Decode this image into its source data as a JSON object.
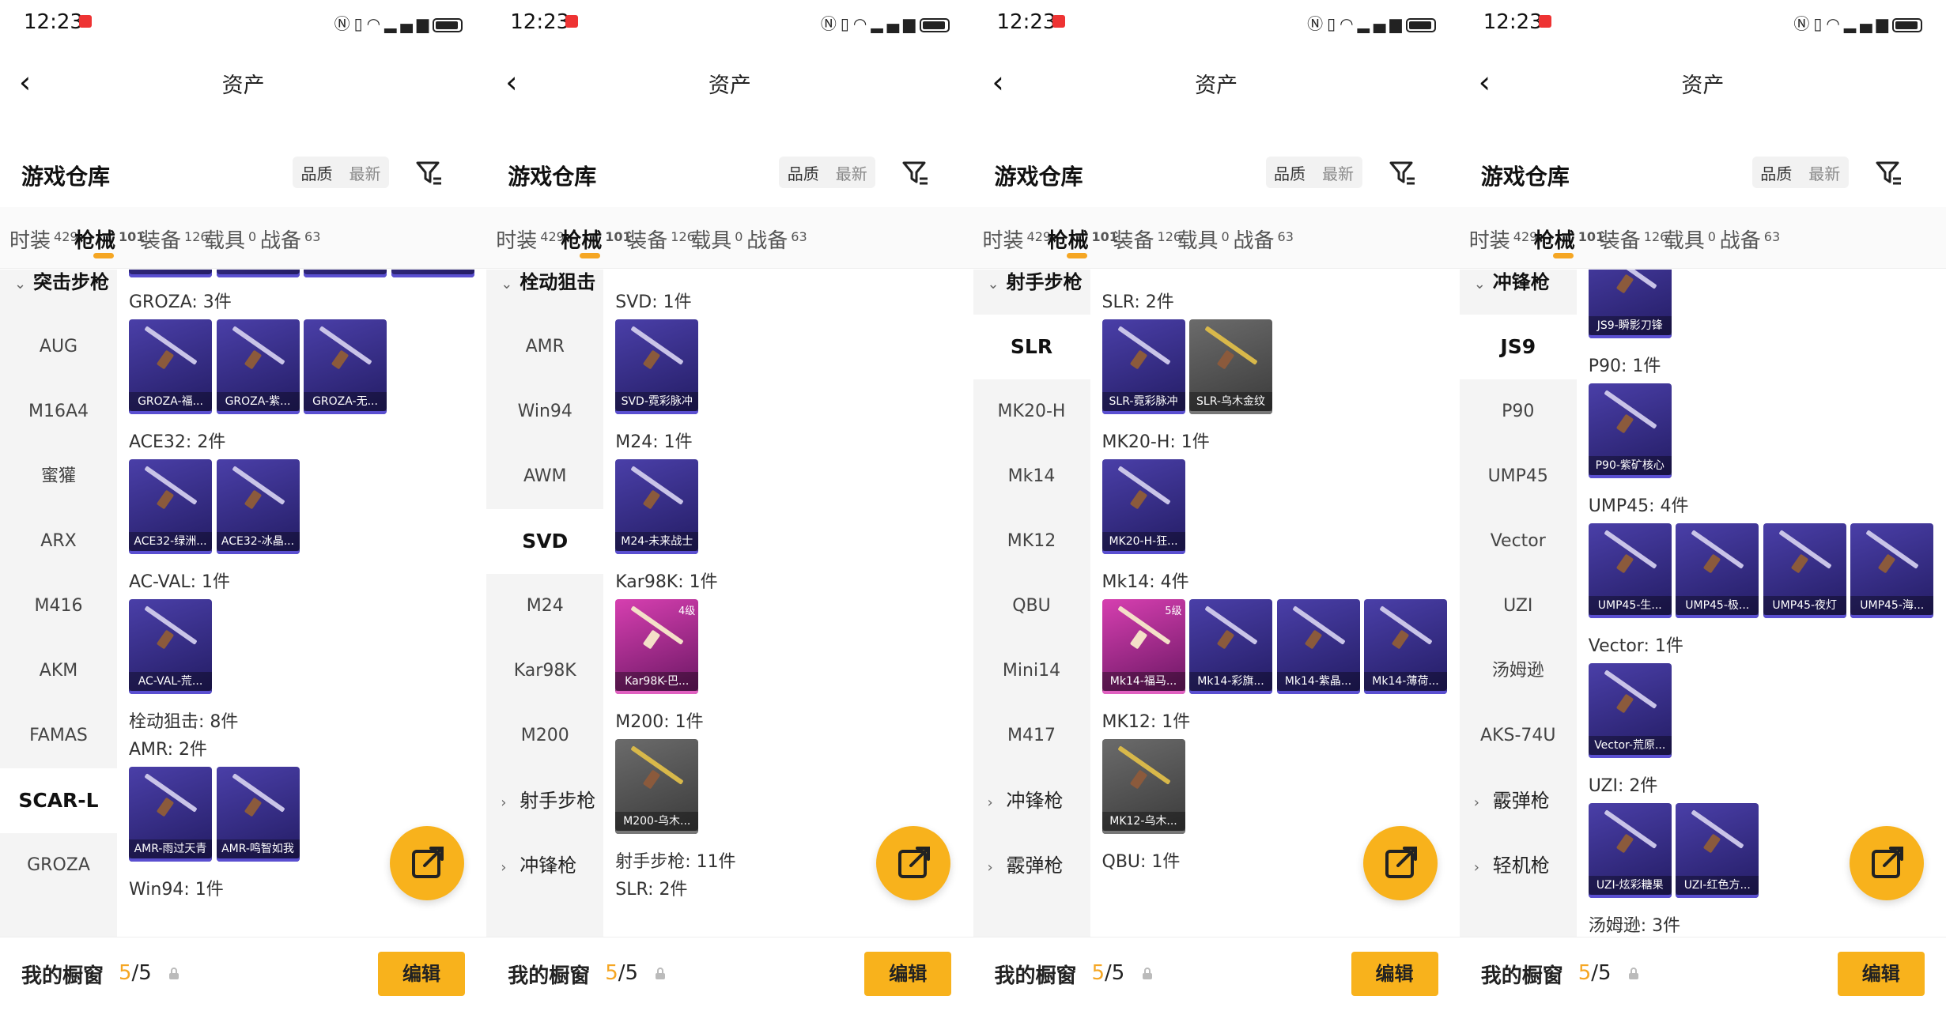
{
  "phones": [
    {
      "status": {
        "time": "12:23"
      },
      "nav": {
        "title": "资产"
      },
      "repo": {
        "title": "游戏仓库",
        "sort_quality": "品质",
        "sort_latest": "最新"
      },
      "tabs": [
        {
          "label": "时装",
          "count": "429"
        },
        {
          "label": "枪械",
          "count": "101"
        },
        {
          "label": "装备",
          "count": "126"
        },
        {
          "label": "载具",
          "count": "0"
        },
        {
          "label": "战备",
          "count": "63"
        }
      ],
      "sidebar": [
        {
          "label": "突击步枪",
          "kind": "group-open"
        },
        {
          "label": "AUG"
        },
        {
          "label": "M16A4"
        },
        {
          "label": "蜜獾"
        },
        {
          "label": "ARX"
        },
        {
          "label": "M416"
        },
        {
          "label": "AKM"
        },
        {
          "label": "FAMAS"
        },
        {
          "label": "SCAR-L",
          "selected": true
        },
        {
          "label": "GROZA"
        }
      ],
      "sections": [
        {
          "title": "GROZA: 3件",
          "items": [
            {
              "name": "GROZA-福...",
              "color": "purple"
            },
            {
              "name": "GROZA-紫...",
              "color": "purple"
            },
            {
              "name": "GROZA-无...",
              "color": "purple"
            }
          ]
        },
        {
          "title": "ACE32: 2件",
          "items": [
            {
              "name": "ACE32-绿洲...",
              "color": "purple"
            },
            {
              "name": "ACE32-冰晶...",
              "color": "purple"
            }
          ]
        },
        {
          "title": "AC-VAL: 1件",
          "items": [
            {
              "name": "AC-VAL-荒...",
              "color": "purple"
            }
          ]
        },
        {
          "title": "栓动狙击: 8件",
          "items": []
        },
        {
          "title": "AMR: 2件",
          "items": [
            {
              "name": "AMR-雨过天青",
              "color": "purple"
            },
            {
              "name": "AMR-鸣智如我",
              "color": "purple"
            }
          ]
        },
        {
          "title": "Win94: 1件",
          "items": []
        }
      ],
      "vitrine": {
        "label": "我的橱窗",
        "current": "5",
        "total": "/5"
      },
      "edit_label": "编辑"
    },
    {
      "status": {
        "time": "12:23"
      },
      "nav": {
        "title": "资产"
      },
      "repo": {
        "title": "游戏仓库",
        "sort_quality": "品质",
        "sort_latest": "最新"
      },
      "tabs": [
        {
          "label": "时装",
          "count": "429"
        },
        {
          "label": "枪械",
          "count": "101"
        },
        {
          "label": "装备",
          "count": "126"
        },
        {
          "label": "载具",
          "count": "0"
        },
        {
          "label": "战备",
          "count": "63"
        }
      ],
      "sidebar": [
        {
          "label": "栓动狙击",
          "kind": "group-open"
        },
        {
          "label": "AMR"
        },
        {
          "label": "Win94"
        },
        {
          "label": "AWM"
        },
        {
          "label": "SVD",
          "selected": true
        },
        {
          "label": "M24"
        },
        {
          "label": "Kar98K"
        },
        {
          "label": "M200"
        },
        {
          "label": "射手步枪",
          "kind": "group"
        },
        {
          "label": "冲锋枪",
          "kind": "group"
        }
      ],
      "sections": [
        {
          "title": "SVD: 1件",
          "items": [
            {
              "name": "SVD-霓彩脉冲",
              "color": "purple"
            }
          ]
        },
        {
          "title": "M24: 1件",
          "items": [
            {
              "name": "M24-未来战士",
              "color": "purple"
            }
          ]
        },
        {
          "title": "Kar98K: 1件",
          "items": [
            {
              "name": "Kar98K-巴...",
              "color": "pink",
              "badge": "4级"
            }
          ]
        },
        {
          "title": "M200: 1件",
          "items": [
            {
              "name": "M200-乌木...",
              "color": "gray"
            }
          ]
        },
        {
          "title": "射手步枪: 11件",
          "items": []
        },
        {
          "title": "SLR: 2件",
          "items": []
        }
      ],
      "vitrine": {
        "label": "我的橱窗",
        "current": "5",
        "total": "/5"
      },
      "edit_label": "编辑"
    },
    {
      "status": {
        "time": "12:23"
      },
      "nav": {
        "title": "资产"
      },
      "repo": {
        "title": "游戏仓库",
        "sort_quality": "品质",
        "sort_latest": "最新"
      },
      "tabs": [
        {
          "label": "时装",
          "count": "429"
        },
        {
          "label": "枪械",
          "count": "101"
        },
        {
          "label": "装备",
          "count": "126"
        },
        {
          "label": "载具",
          "count": "0"
        },
        {
          "label": "战备",
          "count": "63"
        }
      ],
      "sidebar": [
        {
          "label": "射手步枪",
          "kind": "group-open"
        },
        {
          "label": "SLR",
          "selected": true
        },
        {
          "label": "MK20-H"
        },
        {
          "label": "Mk14"
        },
        {
          "label": "MK12"
        },
        {
          "label": "QBU"
        },
        {
          "label": "Mini14"
        },
        {
          "label": "M417"
        },
        {
          "label": "冲锋枪",
          "kind": "group"
        },
        {
          "label": "霰弹枪",
          "kind": "group"
        }
      ],
      "sections": [
        {
          "title": "SLR: 2件",
          "items": [
            {
              "name": "SLR-霓彩脉冲",
              "color": "purple"
            },
            {
              "name": "SLR-乌木金纹",
              "color": "gray"
            }
          ]
        },
        {
          "title": "MK20-H: 1件",
          "items": [
            {
              "name": "MK20-H-狂...",
              "color": "purple"
            }
          ]
        },
        {
          "title": "Mk14: 4件",
          "items": [
            {
              "name": "Mk14-福马...",
              "color": "pink",
              "badge": "5级"
            },
            {
              "name": "Mk14-彩旗...",
              "color": "purple"
            },
            {
              "name": "Mk14-紫晶...",
              "color": "purple"
            },
            {
              "name": "Mk14-薄荷...",
              "color": "purple"
            }
          ]
        },
        {
          "title": "MK12: 1件",
          "items": [
            {
              "name": "MK12-乌木...",
              "color": "gray"
            }
          ]
        },
        {
          "title": "QBU: 1件",
          "items": []
        }
      ],
      "vitrine": {
        "label": "我的橱窗",
        "current": "5",
        "total": "/5"
      },
      "edit_label": "编辑"
    },
    {
      "status": {
        "time": "12:23"
      },
      "nav": {
        "title": "资产"
      },
      "repo": {
        "title": "游戏仓库",
        "sort_quality": "品质",
        "sort_latest": "最新"
      },
      "tabs": [
        {
          "label": "时装",
          "count": "429"
        },
        {
          "label": "枪械",
          "count": "101"
        },
        {
          "label": "装备",
          "count": "126"
        },
        {
          "label": "载具",
          "count": "0"
        },
        {
          "label": "战备",
          "count": "63"
        }
      ],
      "sidebar": [
        {
          "label": "冲锋枪",
          "kind": "group-open"
        },
        {
          "label": "JS9",
          "selected": true
        },
        {
          "label": "P90"
        },
        {
          "label": "UMP45"
        },
        {
          "label": "Vector"
        },
        {
          "label": "UZI"
        },
        {
          "label": "汤姆逊"
        },
        {
          "label": "AKS-74U"
        },
        {
          "label": "霰弹枪",
          "kind": "group"
        },
        {
          "label": "轻机枪",
          "kind": "group"
        }
      ],
      "sections": [
        {
          "title": "",
          "items": [
            {
              "name": "JS9-瞬影刀锋",
              "color": "purple"
            }
          ]
        },
        {
          "title": "P90: 1件",
          "items": [
            {
              "name": "P90-紫矿核心",
              "color": "purple"
            }
          ]
        },
        {
          "title": "UMP45: 4件",
          "items": [
            {
              "name": "UMP45-生...",
              "color": "purple"
            },
            {
              "name": "UMP45-极...",
              "color": "purple"
            },
            {
              "name": "UMP45-夜灯",
              "color": "purple"
            },
            {
              "name": "UMP45-海...",
              "color": "purple"
            }
          ]
        },
        {
          "title": "Vector: 1件",
          "items": [
            {
              "name": "Vector-荒原...",
              "color": "purple"
            }
          ]
        },
        {
          "title": "UZI: 2件",
          "items": [
            {
              "name": "UZI-炫彩糖果",
              "color": "purple"
            },
            {
              "name": "UZI-红色方...",
              "color": "purple"
            }
          ]
        },
        {
          "title": "汤姆逊: 3件",
          "items": []
        }
      ],
      "vitrine": {
        "label": "我的橱窗",
        "current": "5",
        "total": "/5"
      },
      "edit_label": "编辑"
    }
  ]
}
